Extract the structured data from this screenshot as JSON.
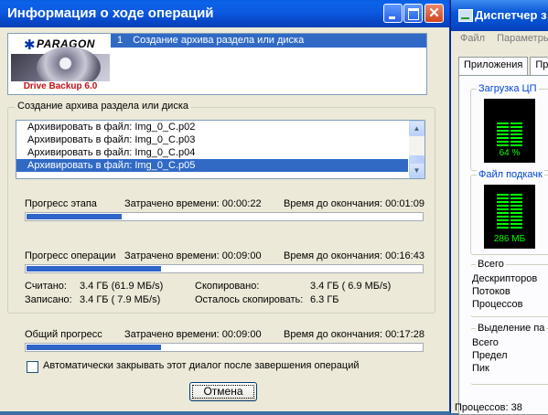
{
  "task_manager": {
    "title": "Диспетчер з",
    "menu": [
      "Файл",
      "Параметры"
    ],
    "tabs": [
      "Приложения",
      "Пр"
    ],
    "cpu_group": "Загрузка ЦП",
    "cpu_value": "64 %",
    "cpu_load": 0.64,
    "pagefile_group": "Файл подкачк",
    "pagefile_value": "286 МБ",
    "totals_group": "Всего",
    "totals_rows": [
      "Дескрипторов",
      "Потоков",
      "Процессов"
    ],
    "memory_group": "Выделение па",
    "memory_rows": [
      "Всего",
      "Предел",
      "Пик"
    ],
    "status": "Процессов: 38"
  },
  "dialog": {
    "title": "Информация о ходе операций",
    "logo": {
      "brand": "PARAGON",
      "product": "Drive Backup 6.0"
    },
    "tasks": [
      {
        "number": "1",
        "label": "Создание архива раздела или диска"
      }
    ],
    "group_title": "Создание архива раздела или диска",
    "files": [
      "Архивировать в файл: Img_0_C.p02",
      "Архивировать в файл: Img_0_C.p03",
      "Архивировать в файл: Img_0_C.p04",
      "Архивировать в файл: Img_0_C.p05"
    ],
    "selected_file_index": 3,
    "stage": {
      "label": "Прогресс этапа",
      "elapsed": "Затрачено времени: 00:00:22",
      "remaining": "Время до окончания: 00:01:09",
      "progress": 0.24
    },
    "operation": {
      "label": "Прогресс операции",
      "elapsed": "Затрачено времени: 00:09:00",
      "remaining": "Время до окончания: 00:16:43",
      "progress": 0.34
    },
    "stats": {
      "read_label": "Считано:",
      "read_value": "3.4 ГБ (61.9 МБ/s)",
      "written_label": "Записано:",
      "written_value": "3.4 ГБ ( 7.9 МБ/s)",
      "copied_label": "Скопировано:",
      "copied_value": "3.4 ГБ ( 6.9 МБ/s)",
      "left_label": "Осталось скопировать:",
      "left_value": "6.3 ГБ"
    },
    "overall": {
      "label": "Общий прогресс",
      "elapsed": "Затрачено времени: 00:09:00",
      "remaining": "Время до окончания: 00:17:28",
      "progress": 0.34
    },
    "auto_close_label": "Автоматически закрывать этот диалог после завершения операций",
    "auto_close_checked": false,
    "cancel_label": "Отмена"
  },
  "colors": {
    "titlebar": "#0a5de0",
    "selection": "#316ac5",
    "progress_fill": "#2f64c8",
    "window_bg": "#ece9d8"
  }
}
